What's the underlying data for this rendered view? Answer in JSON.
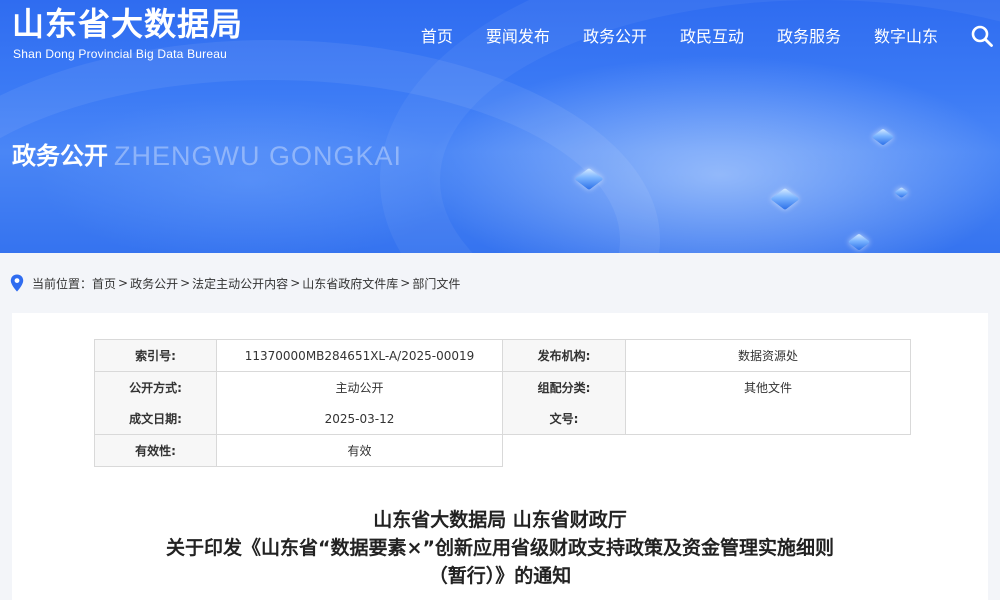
{
  "site": {
    "name_cn": "山东省大数据局",
    "name_en": "Shan Dong Provincial Big Data Bureau"
  },
  "nav": {
    "items": [
      "首页",
      "要闻发布",
      "政务公开",
      "政民互动",
      "政务服务",
      "数字山东"
    ],
    "search_icon": "search-icon"
  },
  "banner": {
    "title": "政务公开",
    "subtitle": "ZHENGWU GONGKAI"
  },
  "breadcrumb": {
    "icon": "location-pin-icon",
    "label": "当前位置：",
    "items": [
      "首页",
      "政务公开",
      "法定主动公开内容",
      "山东省政府文件库",
      "部门文件"
    ],
    "separator": ">"
  },
  "meta_table": {
    "index_no_label": "索引号:",
    "index_no": "11370000MB284651XL-A/2025-00019",
    "issuer_label": "发布机构:",
    "issuer": "数据资源处",
    "open_mode_label": "公开方式:",
    "open_mode": "主动公开",
    "category_label": "组配分类:",
    "category": "其他文件",
    "date_label": "成文日期:",
    "date": "2025-03-12",
    "doc_no_label": "文号:",
    "doc_no": "",
    "validity_label": "有效性:",
    "validity": "有效"
  },
  "document": {
    "title_line1": "山东省大数据局 山东省财政厅",
    "title_line2": "关于印发《山东省“数据要素×”创新应用省级财政支持政策及资金管理实施细则",
    "title_line3": "（暂行）》的通知"
  },
  "colors": {
    "banner_blue": "#3b7af5",
    "pin_blue": "#2f6cf0"
  }
}
